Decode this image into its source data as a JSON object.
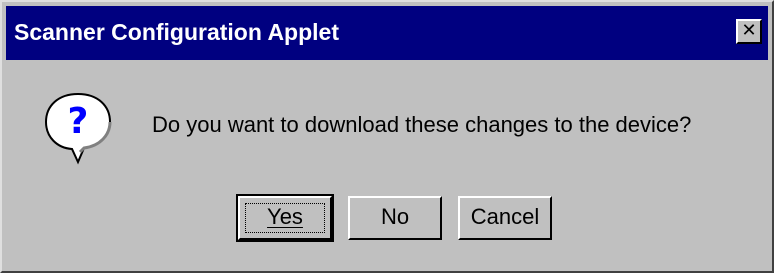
{
  "window": {
    "title": "Scanner Configuration Applet",
    "close_label": "✕",
    "titlebar_color": "#000080",
    "face_color": "#c0c0c0"
  },
  "message": {
    "icon": "question-icon",
    "text": "Do you want to download these changes to the device?"
  },
  "buttons": {
    "yes_label": "Yes",
    "no_label": "No",
    "cancel_label": "Cancel"
  }
}
